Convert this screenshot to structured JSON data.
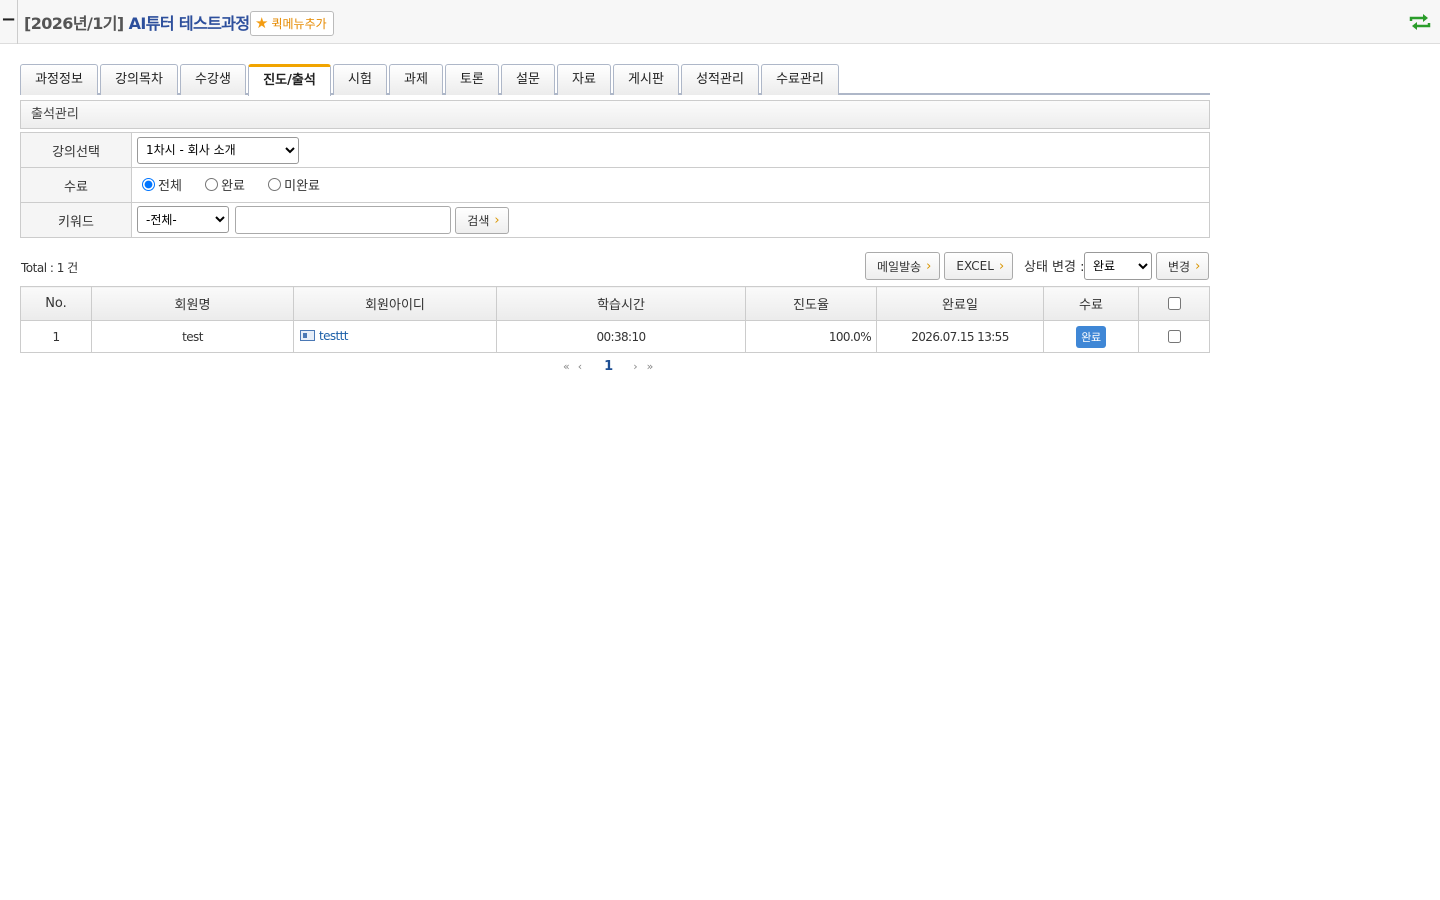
{
  "header": {
    "collapse_glyph": "−",
    "term": "[2026년/1기]",
    "course": "AI튜터 테스트과정",
    "quick_menu_label": "퀵메뉴추가"
  },
  "tabs": [
    "과정정보",
    "강의목차",
    "수강생",
    "진도/출석",
    "시험",
    "과제",
    "토론",
    "설문",
    "자료",
    "게시판",
    "성적관리",
    "수료관리"
  ],
  "active_tab": "진도/출석",
  "section_title": "출석관리",
  "form": {
    "lecture_label": "강의선택",
    "lecture_selected": "1차시 - 회사 소개",
    "completion_label": "수료",
    "completion_options": [
      "전체",
      "완료",
      "미완료"
    ],
    "keyword_label": "키워드",
    "keyword_field_selected": "-전체-",
    "keyword_value": "",
    "search_button": "검색"
  },
  "toolbar": {
    "total_text": "Total : 1 건",
    "mail_button": "메일발송",
    "excel_button": "EXCEL",
    "status_change_label": "상태 변경 :",
    "status_selected": "완료",
    "change_button": "변경"
  },
  "table": {
    "columns": [
      "No.",
      "회원명",
      "회원아이디",
      "학습시간",
      "진도율",
      "완료일",
      "수료"
    ],
    "rows": [
      {
        "no": "1",
        "name": "test",
        "member_id": "testtt",
        "study_time": "00:38:10",
        "progress": "100.0%",
        "completed_at": "2026.07.15 13:55",
        "status": "완료"
      }
    ]
  },
  "pager": {
    "first": "«",
    "prev": "‹",
    "current": "1",
    "next": "›",
    "last": "»"
  },
  "colors": {
    "accent": "#f1a400",
    "link": "#1b5fa8",
    "badge": "#3f87d6",
    "refresh": "#2a9d2a"
  }
}
